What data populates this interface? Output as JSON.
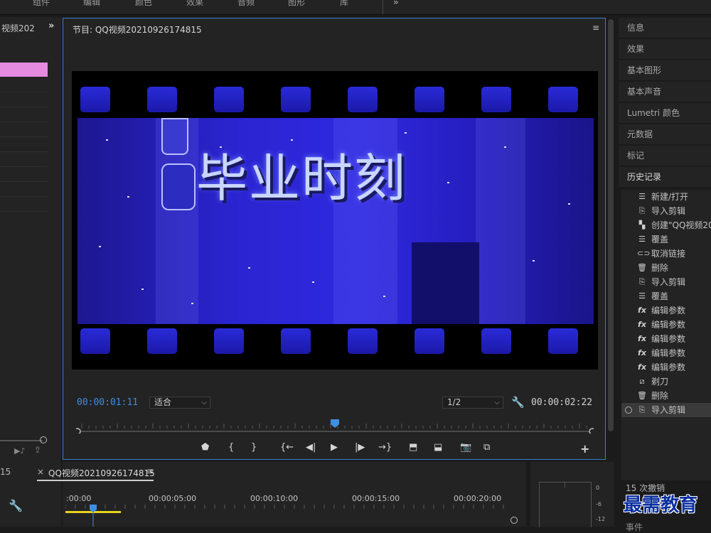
{
  "workspaces": [
    "组件",
    "编辑",
    "颜色",
    "效果",
    "音频",
    "图形",
    "库"
  ],
  "left_panel": {
    "title": "视频202",
    "more_icon": "»"
  },
  "program_monitor": {
    "title": "节目: QQ视频20210926174815",
    "menu_icon": "≡",
    "video_text": "毕业时刻",
    "timecode_current": "00:00:01:11",
    "zoom_select": "适合",
    "resolution_select": "1/2",
    "timecode_duration": "00:00:02:22",
    "playhead_fraction": 0.5
  },
  "right_panel": {
    "items": [
      "信息",
      "效果",
      "基本图形",
      "基本声音",
      "Lumetri 颜色",
      "元数据",
      "标记",
      "历史记录"
    ],
    "active": "历史记录",
    "history": [
      {
        "icon": "list-icon",
        "label": "新建/打开"
      },
      {
        "icon": "import-icon",
        "label": "导入剪辑"
      },
      {
        "icon": "sequence-icon",
        "label": "创建\"QQ视频20"
      },
      {
        "icon": "list-icon",
        "label": "覆盖"
      },
      {
        "icon": "link-icon",
        "label": "取消链接"
      },
      {
        "icon": "trash-icon",
        "label": "删除"
      },
      {
        "icon": "import-icon",
        "label": "导入剪辑"
      },
      {
        "icon": "list-icon",
        "label": "覆盖"
      },
      {
        "icon": "fx-icon",
        "label": "编辑参数"
      },
      {
        "icon": "fx-icon",
        "label": "编辑参数"
      },
      {
        "icon": "fx-icon",
        "label": "编辑参数"
      },
      {
        "icon": "fx-icon",
        "label": "编辑参数"
      },
      {
        "icon": "fx-icon",
        "label": "编辑参数"
      },
      {
        "icon": "razor-icon",
        "label": "剃刀"
      },
      {
        "icon": "trash-icon",
        "label": "删除"
      },
      {
        "icon": "import-icon",
        "label": "导入剪辑"
      }
    ],
    "undo_count": "15 次撤销",
    "bottom_label": "事件"
  },
  "timeline": {
    "left_number": "15",
    "close_icon": "×",
    "tab_title": "QQ视频20210926174815",
    "tab_menu": "≡",
    "timecodes": [
      ":00:00",
      "00:00:05:00",
      "00:00:10:00",
      "00:00:15:00",
      "00:00:20:00"
    ]
  },
  "audio_meter": {
    "labels": [
      "0",
      "-6",
      "-12"
    ]
  },
  "watermark": "最需教育"
}
